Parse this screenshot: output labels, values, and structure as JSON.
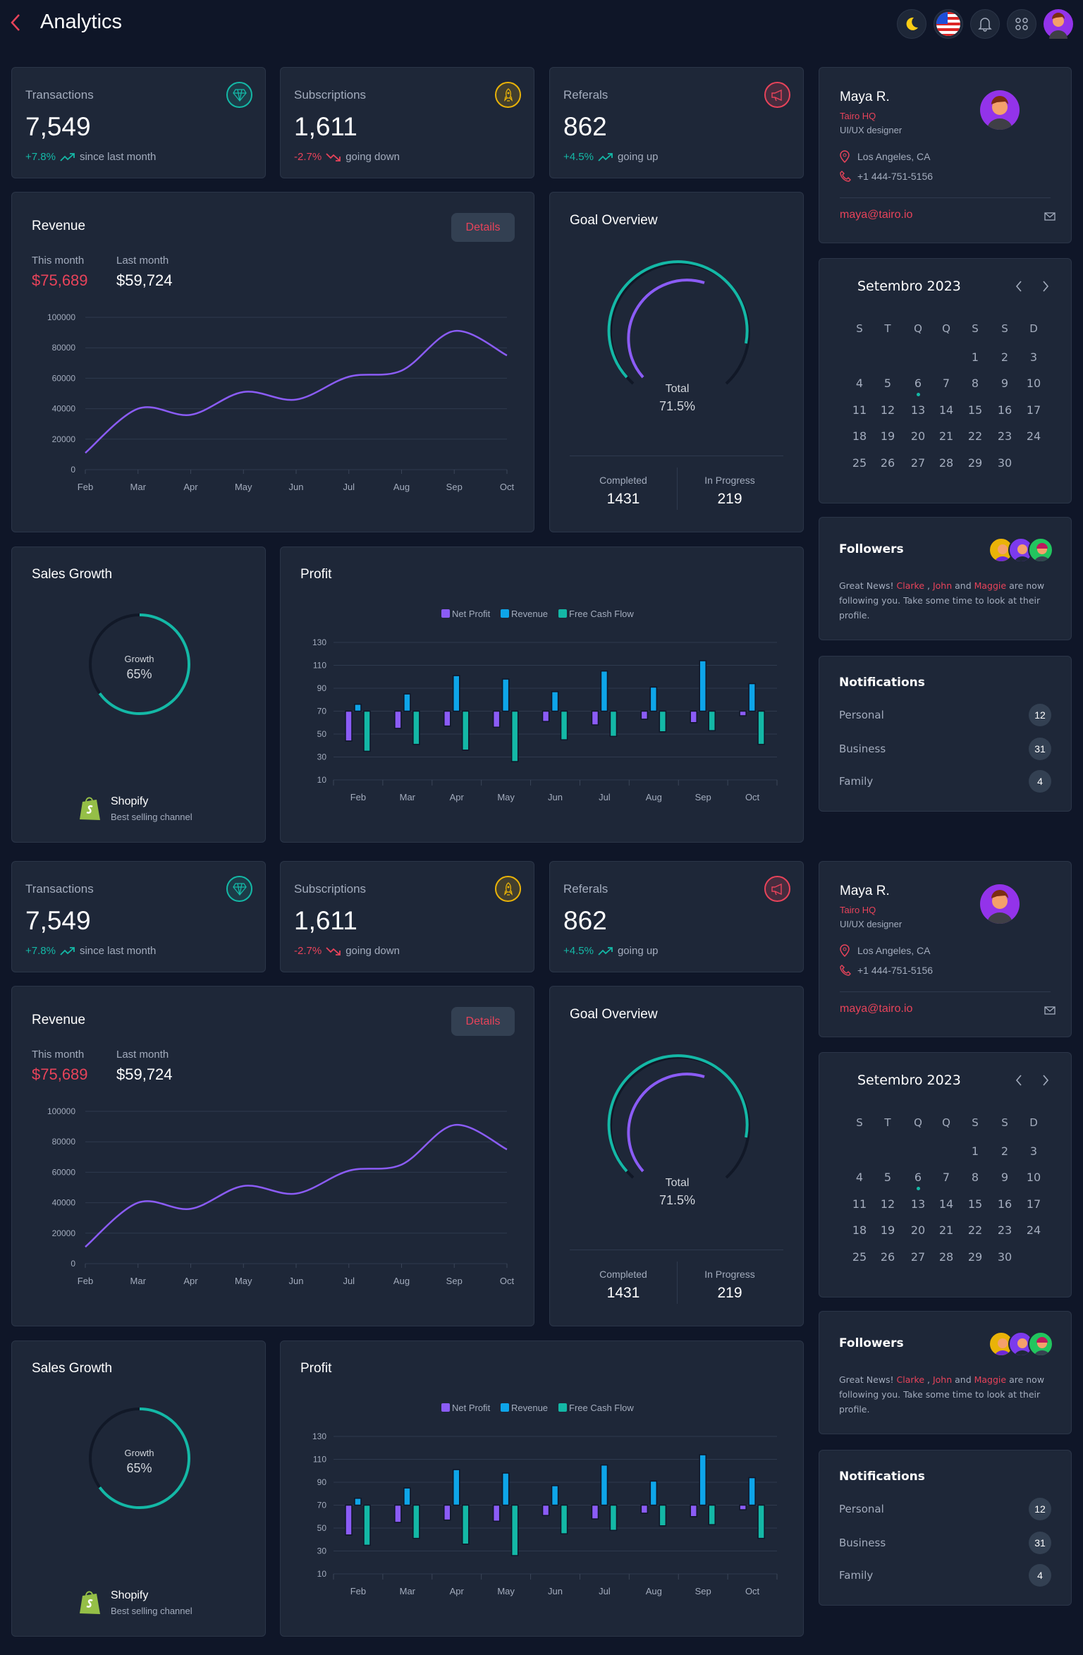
{
  "header": {
    "title": "Analytics",
    "icons": [
      "moon-icon",
      "us-flag-icon",
      "bell-icon",
      "apps-grid-icon",
      "user-avatar"
    ]
  },
  "colors": {
    "background": "#0f1628",
    "card": "#1e2738",
    "accent_red": "#e8435a",
    "teal": "#14b8a6",
    "purple": "#8b5cf6",
    "blue": "#0ea5e9",
    "yellow": "#eab308"
  },
  "stats": [
    {
      "label": "Transactions",
      "value": "7,549",
      "delta": "+7.8%",
      "delta_text": "since last month",
      "trend": "up",
      "icon": "gem-icon",
      "color": "#14b8a6"
    },
    {
      "label": "Subscriptions",
      "value": "1,611",
      "delta": "-2.7%",
      "delta_text": "going down",
      "trend": "down",
      "icon": "rocket-icon",
      "color": "#eab308"
    },
    {
      "label": "Referals",
      "value": "862",
      "delta": "+4.5%",
      "delta_text": "going up",
      "trend": "up",
      "icon": "megaphone-icon",
      "color": "#e8435a"
    }
  ],
  "profile": {
    "name": "Maya R.",
    "company": "Tairo HQ",
    "role": "UI/UX designer",
    "location": "Los Angeles, CA",
    "phone": "+1 444-751-5156",
    "email": "maya@tairo.io"
  },
  "revenue": {
    "title": "Revenue",
    "details_label": "Details",
    "this_month_label": "This month",
    "this_month_value": "$75,689",
    "last_month_label": "Last month",
    "last_month_value": "$59,724"
  },
  "goal": {
    "title": "Goal Overview",
    "center_label": "Total",
    "percent": "71.5%",
    "completed_label": "Completed",
    "completed_value": "1431",
    "in_progress_label": "In Progress",
    "in_progress_value": "219"
  },
  "sales_growth": {
    "title": "Sales Growth",
    "label": "Growth",
    "value": "65%",
    "percent": 65,
    "channel": "Shopify",
    "channel_caption": "Best selling channel"
  },
  "profit": {
    "title": "Profit"
  },
  "calendar": {
    "title": "Setembro 2023",
    "weekdays": [
      "S",
      "T",
      "Q",
      "Q",
      "S",
      "S",
      "D"
    ],
    "days_in_month": 30,
    "marked_day": 6
  },
  "followers": {
    "title": "Followers",
    "text_1": "Great News! ",
    "name_1": "Clarke",
    "sep_1": " , ",
    "name_2": "John",
    "sep_2": " and ",
    "name_3": "Maggie",
    "text_2": " are now following you. Take some time to look at their profile."
  },
  "notifications": {
    "title": "Notifications",
    "items": [
      {
        "label": "Personal",
        "count": "12"
      },
      {
        "label": "Business",
        "count": "31"
      },
      {
        "label": "Family",
        "count": "4"
      }
    ]
  },
  "chart_data": [
    {
      "type": "line",
      "categories": [
        "Feb",
        "Mar",
        "Apr",
        "May",
        "Jun",
        "Jul",
        "Aug",
        "Sep",
        "Oct"
      ],
      "values": [
        11000,
        40000,
        36000,
        51000,
        46000,
        61000,
        65000,
        91000,
        75000
      ],
      "ylim": [
        0,
        100000
      ],
      "yticks": [
        0,
        20000,
        40000,
        60000,
        80000,
        100000
      ],
      "grid": true,
      "color": "#8b5cf6"
    },
    {
      "type": "bar",
      "categories": [
        "Feb",
        "Mar",
        "Apr",
        "May",
        "Jun",
        "Jul",
        "Aug",
        "Sep",
        "Oct"
      ],
      "baseline": 70,
      "ylim": [
        10,
        130
      ],
      "yticks": [
        10,
        30,
        50,
        70,
        90,
        110,
        130
      ],
      "grid": true,
      "legend": "top",
      "series": [
        {
          "name": "Net Profit",
          "color": "#8b5cf6",
          "values": [
            44,
            55,
            57,
            56,
            61,
            58,
            63,
            60,
            66
          ]
        },
        {
          "name": "Revenue",
          "color": "#0ea5e9",
          "values": [
            76,
            85,
            101,
            98,
            87,
            105,
            91,
            114,
            94
          ]
        },
        {
          "name": "Free Cash Flow",
          "color": "#14b8a6",
          "values": [
            35,
            41,
            36,
            26,
            45,
            48,
            52,
            53,
            41
          ]
        }
      ]
    }
  ]
}
